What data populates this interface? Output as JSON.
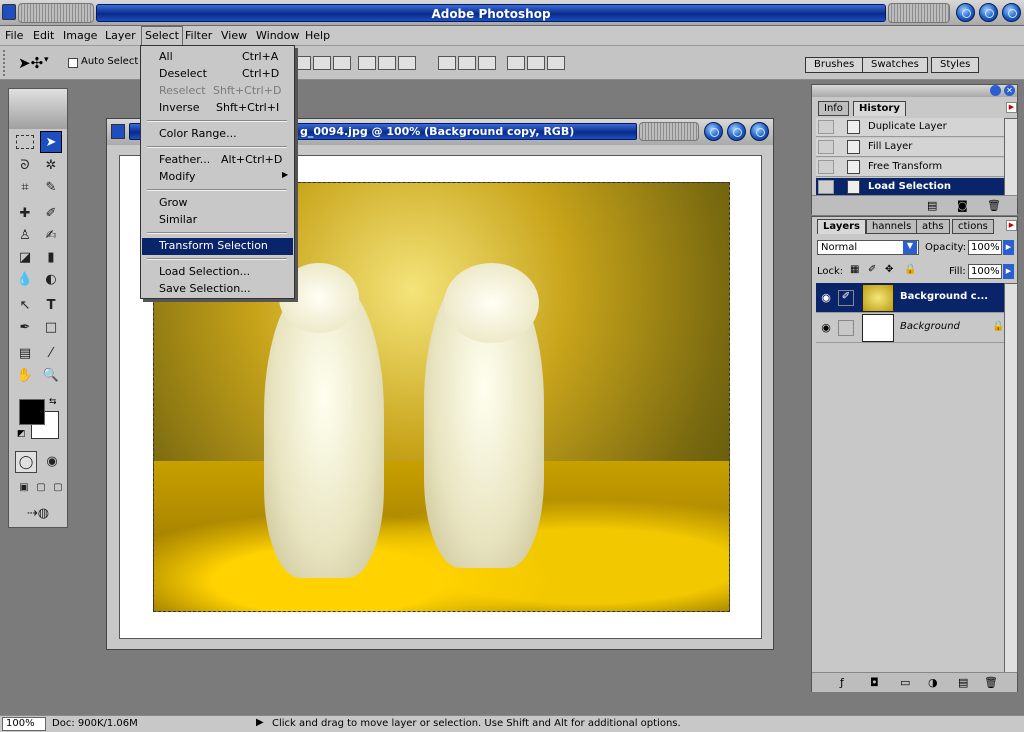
{
  "app": {
    "title": "Adobe Photoshop"
  },
  "menubar": {
    "items": [
      "File",
      "Edit",
      "Image",
      "Layer",
      "Select",
      "Filter",
      "View",
      "Window",
      "Help"
    ]
  },
  "options": {
    "auto_select_label": "Auto Select L"
  },
  "palette_well": {
    "tabs": [
      "Brushes",
      "Swatches",
      "Styles"
    ]
  },
  "document": {
    "title": "g_0094.jpg @ 100% (Background copy, RGB)"
  },
  "select_menu": {
    "items": [
      {
        "label": "All",
        "shortcut": "Ctrl+A",
        "state": "normal"
      },
      {
        "label": "Deselect",
        "shortcut": "Ctrl+D",
        "state": "normal"
      },
      {
        "label": "Reselect",
        "shortcut": "Shft+Ctrl+D",
        "state": "disabled"
      },
      {
        "label": "Inverse",
        "shortcut": "Shft+Ctrl+I",
        "state": "normal"
      },
      {
        "label": "Color Range...",
        "shortcut": "",
        "state": "normal"
      },
      {
        "label": "Feather...",
        "shortcut": "Alt+Ctrl+D",
        "state": "normal"
      },
      {
        "label": "Modify",
        "shortcut": "",
        "state": "submenu"
      },
      {
        "label": "Grow",
        "shortcut": "",
        "state": "normal"
      },
      {
        "label": "Similar",
        "shortcut": "",
        "state": "normal"
      },
      {
        "label": "Transform Selection",
        "shortcut": "",
        "state": "highlighted"
      },
      {
        "label": "Load Selection...",
        "shortcut": "",
        "state": "normal"
      },
      {
        "label": "Save Selection...",
        "shortcut": "",
        "state": "normal"
      }
    ]
  },
  "history_panel": {
    "tabs": [
      "Info",
      "History"
    ],
    "active_tab": "History",
    "items": [
      "Duplicate Layer",
      "Fill Layer",
      "Free Transform",
      "Load Selection"
    ],
    "selected": "Load Selection"
  },
  "layers_panel": {
    "tabs": [
      "Layers",
      "Channels",
      "Paths",
      "Actions"
    ],
    "tab_labels_shown": [
      "Layers",
      "hannels",
      "aths",
      "ctions"
    ],
    "blend_mode": "Normal",
    "opacity_label": "Opacity:",
    "opacity": "100%",
    "lock_label": "Lock:",
    "fill_label": "Fill:",
    "fill": "100%",
    "layers": [
      {
        "name": "Background c...",
        "selected": true
      },
      {
        "name": "Background",
        "selected": false,
        "locked": true
      }
    ]
  },
  "status": {
    "zoom": "100%",
    "doc_info": "Doc: 900K/1.06M",
    "hint": "Click and drag to move layer or selection.  Use Shift and Alt for additional options."
  },
  "colors": {
    "title_bar": "#0a2a8a",
    "highlight": "#0a246a",
    "chrome": "#c8c8c8"
  }
}
